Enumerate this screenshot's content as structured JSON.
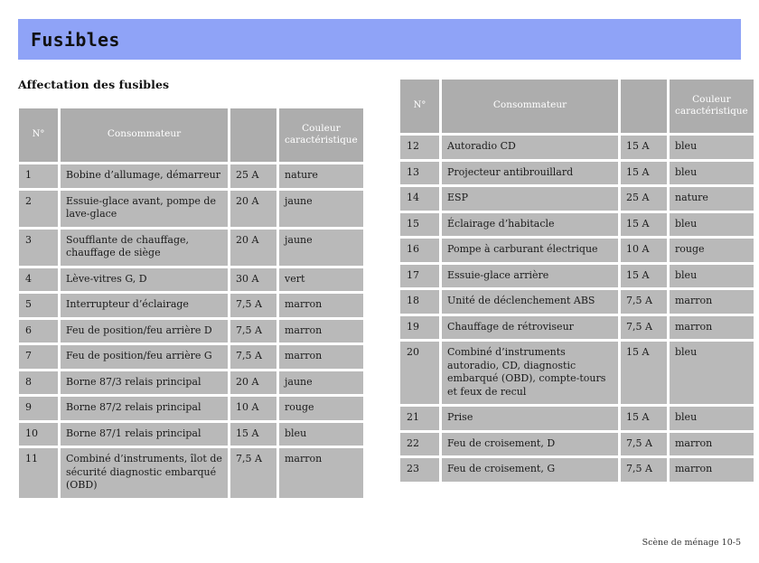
{
  "banner": {
    "title": "Fusibles",
    "color": "#8fa3f7"
  },
  "section": {
    "heading": "Affectation des fusibles"
  },
  "palette": {
    "header_gray": "#adadad",
    "cell_gray": "#b9b9b9",
    "page_background": "#ffffff",
    "text": "#1b1b1b"
  },
  "table_left": {
    "columns": [
      {
        "key": "no",
        "label": "N°"
      },
      {
        "key": "name",
        "label": "Consommateur"
      },
      {
        "key": "amp",
        "label": ""
      },
      {
        "key": "color",
        "label": "Couleur caractéristique"
      }
    ],
    "rows": [
      {
        "no": "1",
        "name": "Bobine d’allumage, démarreur",
        "amp": "25 A",
        "color": "nature"
      },
      {
        "no": "2",
        "name": "Essuie-glace avant, pompe de lave-glace",
        "amp": "20 A",
        "color": "jaune"
      },
      {
        "no": "3",
        "name": "Soufflante de chauffage, chauffage de siège",
        "amp": "20 A",
        "color": "jaune"
      },
      {
        "no": "4",
        "name": "Lève-vitres G, D",
        "amp": "30 A",
        "color": "vert"
      },
      {
        "no": "5",
        "name": "Interrupteur d’éclairage",
        "amp": "7,5 A",
        "color": "marron"
      },
      {
        "no": "6",
        "name": "Feu de position/feu arrière D",
        "amp": "7,5 A",
        "color": "marron"
      },
      {
        "no": "7",
        "name": "Feu de position/feu arrière G",
        "amp": "7,5 A",
        "color": "marron"
      },
      {
        "no": "8",
        "name": "Borne 87/3 relais principal",
        "amp": "20 A",
        "color": "jaune"
      },
      {
        "no": "9",
        "name": "Borne 87/2 relais principal",
        "amp": "10 A",
        "color": "rouge"
      },
      {
        "no": "10",
        "name": "Borne 87/1 relais principal",
        "amp": "15 A",
        "color": "bleu"
      },
      {
        "no": "11",
        "name": "Combiné d’instruments, îlot de sécurité diagnostic embarqué (OBD)",
        "amp": "7,5 A",
        "color": "marron"
      }
    ]
  },
  "table_right": {
    "columns": [
      {
        "key": "no",
        "label": "N°"
      },
      {
        "key": "name",
        "label": "Consommateur"
      },
      {
        "key": "amp",
        "label": ""
      },
      {
        "key": "color",
        "label": "Couleur caractéristique"
      }
    ],
    "rows": [
      {
        "no": "12",
        "name": "Autoradio CD",
        "amp": "15 A",
        "color": "bleu"
      },
      {
        "no": "13",
        "name": "Projecteur antibrouillard",
        "amp": "15 A",
        "color": "bleu"
      },
      {
        "no": "14",
        "name": "ESP",
        "amp": "25 A",
        "color": "nature"
      },
      {
        "no": "15",
        "name": "Éclairage d’habitacle",
        "amp": "15 A",
        "color": "bleu"
      },
      {
        "no": "16",
        "name": "Pompe à carburant électrique",
        "amp": "10 A",
        "color": "rouge"
      },
      {
        "no": "17",
        "name": "Essuie-glace arrière",
        "amp": "15 A",
        "color": "bleu"
      },
      {
        "no": "18",
        "name": "Unité de déclenchement ABS",
        "amp": "7,5 A",
        "color": "marron"
      },
      {
        "no": "19",
        "name": "Chauffage de rétroviseur",
        "amp": "7,5 A",
        "color": "marron"
      },
      {
        "no": "20",
        "name": "Combiné d’instruments autoradio, CD, diagnostic embarqué (OBD), compte-tours et feux de recul",
        "amp": "15 A",
        "color": "bleu"
      },
      {
        "no": "21",
        "name": "Prise",
        "amp": "15 A",
        "color": "bleu"
      },
      {
        "no": "22",
        "name": "Feu de croisement, D",
        "amp": "7,5 A",
        "color": "marron"
      },
      {
        "no": "23",
        "name": "Feu de croisement, G",
        "amp": "7,5 A",
        "color": "marron"
      }
    ]
  },
  "footer": {
    "text": "Scène de ménage  10-5"
  }
}
